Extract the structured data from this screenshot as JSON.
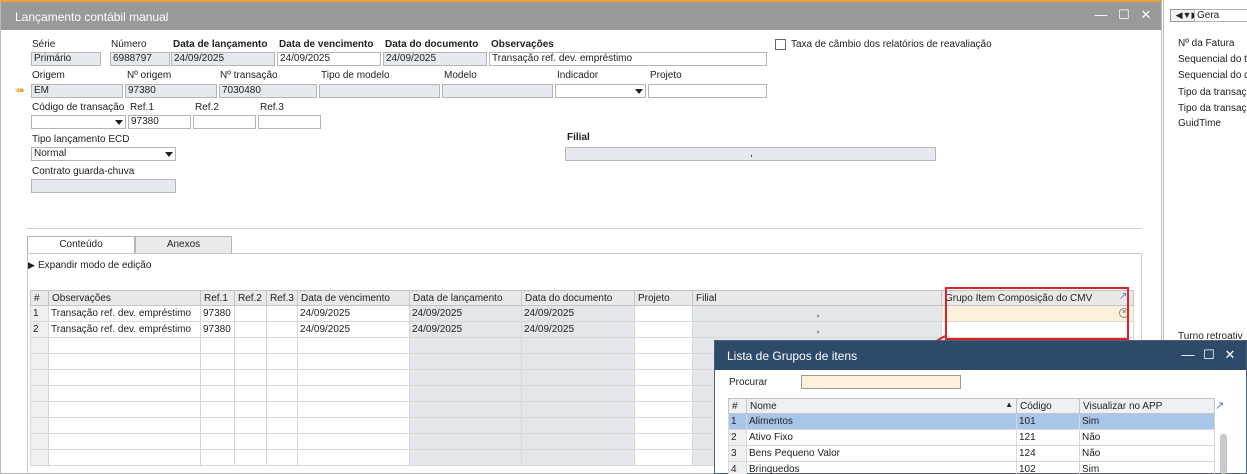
{
  "window": {
    "title": "Lançamento contábil manual",
    "min_icon": "minimize-icon",
    "max_icon": "maximize-icon",
    "close_icon": "close-icon"
  },
  "header": {
    "serie": {
      "label": "Série",
      "value": "Primário"
    },
    "numero": {
      "label": "Número",
      "value": "6988797"
    },
    "data_lancamento": {
      "label": "Data de lançamento",
      "value": "24/09/2025"
    },
    "data_vencimento": {
      "label": "Data de vencimento",
      "value": "24/09/2025"
    },
    "data_documento": {
      "label": "Data do documento",
      "value": "24/09/2025"
    },
    "observacoes": {
      "label": "Observações",
      "value": "Transação ref. dev. empréstimo"
    },
    "taxa_cambio": {
      "label": "Taxa de câmbio dos relatórios de reavaliação"
    },
    "origem": {
      "label": "Origem",
      "value": "EM"
    },
    "n_origem": {
      "label": "Nº origem",
      "value": "97380"
    },
    "n_transacao": {
      "label": "Nº transação",
      "value": "7030480"
    },
    "tipo_modelo": {
      "label": "Tipo de modelo",
      "value": ""
    },
    "modelo": {
      "label": "Modelo",
      "value": ""
    },
    "indicador": {
      "label": "Indicador",
      "value": ""
    },
    "projeto": {
      "label": "Projeto",
      "value": ""
    },
    "codigo_transacao": {
      "label": "Código de transação",
      "value": ""
    },
    "ref1": {
      "label": "Ref.1",
      "value": "97380"
    },
    "ref2": {
      "label": "Ref.2",
      "value": ""
    },
    "ref3": {
      "label": "Ref.3",
      "value": ""
    },
    "tipo_ecd": {
      "label": "Tipo lançamento ECD",
      "value": "Normal"
    },
    "filial": {
      "label": "Filial",
      "value": ","
    },
    "contrato": {
      "label": "Contrato guarda-chuva",
      "value": ""
    }
  },
  "tabs": [
    {
      "label": "Conteúdo",
      "active": true
    },
    {
      "label": "Anexos",
      "active": false
    }
  ],
  "expand_label": "Expandir modo de edição",
  "grid": {
    "columns": [
      "#",
      "Observações",
      "Ref.1",
      "Ref.2",
      "Ref.3",
      "Data de vencimento",
      "Data de lançamento",
      "Data do documento",
      "Projeto",
      "Filial",
      "Grupo Item Composição do CMV"
    ],
    "rows": [
      [
        "1",
        "Transação ref. dev. empréstimo",
        "97380",
        "",
        "",
        "24/09/2025",
        "24/09/2025",
        "24/09/2025",
        "",
        ",",
        ""
      ],
      [
        "2",
        "Transação ref. dev. empréstimo",
        "97380",
        "",
        "",
        "24/09/2025",
        "24/09/2025",
        "24/09/2025",
        "",
        ",",
        ""
      ]
    ]
  },
  "side_panel": {
    "nav_combo": "Gera",
    "labels": [
      "Nº da Fatura",
      "Sequencial do t",
      "Sequencial do d",
      "Tipo da transaç",
      "Tipo da transaç",
      "GuidTime"
    ],
    "bottom_label": "Turno retroativ"
  },
  "popup": {
    "title": "Lista de Grupos de itens",
    "search_label": "Procurar",
    "search_value": "",
    "columns": [
      "#",
      "Nome",
      "Código",
      "Visualizar no APP"
    ],
    "rows": [
      [
        "1",
        "Alimentos",
        "101",
        "Sim"
      ],
      [
        "2",
        "Ativo Fixo",
        "121",
        "Não"
      ],
      [
        "3",
        "Bens Pequeno Valor",
        "124",
        "Não"
      ],
      [
        "4",
        "Brinquedos",
        "102",
        "Sim"
      ]
    ]
  },
  "colors": {
    "accent_top": "#e8a33a",
    "popup_title": "#2e4a6b",
    "highlight": "#e0202a",
    "selected_row": "#a9c5ea"
  }
}
